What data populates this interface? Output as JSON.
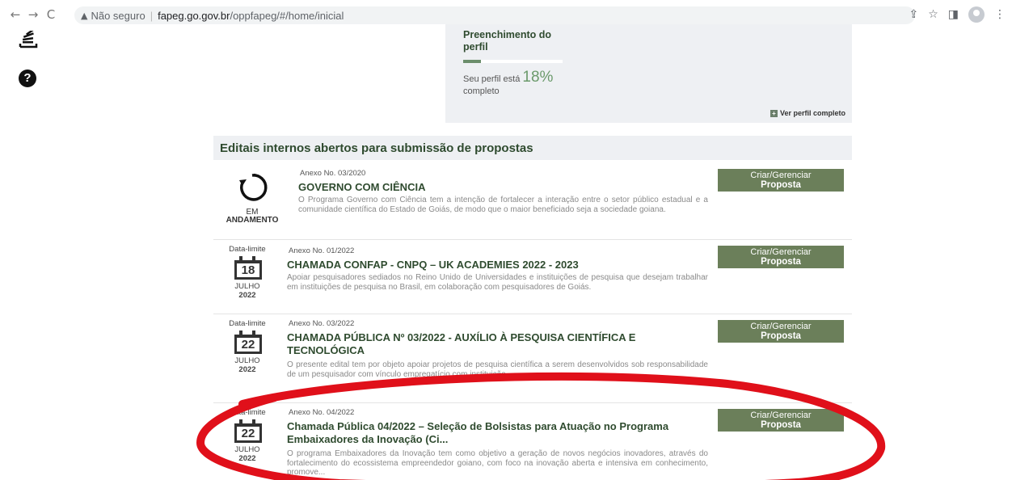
{
  "browser": {
    "insecure_label": "Não seguro",
    "url_host": "fapeg.go.gov.br",
    "url_path": "/oppfapeg/#/home/inicial"
  },
  "profile": {
    "title": "Preenchimento do perfil",
    "progress": 0.18,
    "status_prefix": "Seu perfil está",
    "percent": "18%",
    "status_suffix": "completo",
    "link_label": "Ver perfil completo"
  },
  "section": {
    "heading": "Editais internos abertos para submissão de propostas"
  },
  "notices": [
    {
      "annex": "Anexo No. 03/2020",
      "title": "GOVERNO COM CIÊNCIA",
      "desc": "O Programa Governo com Ciência tem a intenção de fortalecer a interação entre o setor público estadual e a comunidade científica do Estado de Goiás, de modo que o maior beneficiado seja a sociedade goiana.",
      "status_line1": "EM",
      "status_line2": "ANDAMENTO",
      "button_line1": "Criar/Gerenciar",
      "button_line2": "Proposta"
    },
    {
      "annex": "Anexo No. 01/2022",
      "title": "CHAMADA CONFAP - CNPQ – UK ACADEMIES 2022 - 2023",
      "desc": "Apoiar pesquisadores sediados no Reino Unido de Universidades e instituições de pesquisa que desejam trabalhar em instituições de pesquisa no Brasil, em colaboração com pesquisadores de Goiás.",
      "deadline_label": "Data-limite",
      "day": "18",
      "month": "JULHO",
      "year": "2022",
      "button_line1": "Criar/Gerenciar",
      "button_line2": "Proposta"
    },
    {
      "annex": "Anexo No. 03/2022",
      "title": "CHAMADA PÚBLICA Nº 03/2022 - AUXÍLIO À PESQUISA CIENTÍFICA E TECNOLÓGICA",
      "desc": "O presente edital tem por objeto apoiar projetos de pesquisa científica a serem desenvolvidos sob responsabilidade de um pesquisador com vínculo empregatício com instituição ...",
      "deadline_label": "Data-limite",
      "day": "22",
      "month": "JULHO",
      "year": "2022",
      "button_line1": "Criar/Gerenciar",
      "button_line2": "Proposta"
    },
    {
      "annex": "Anexo No. 04/2022",
      "title": "Chamada Pública 04/2022 – Seleção de Bolsistas para Atuação no Programa Embaixadores da Inovação (Ci...",
      "desc": "O programa Embaixadores da Inovação tem como objetivo a geração de novos negócios inovadores, através do fortalecimento do ecossistema empreendedor goiano, com foco na inovação aberta e intensiva em conhecimento, promove...",
      "deadline_label": "Data-limite",
      "day": "22",
      "month": "JULHO",
      "year": "2022",
      "button_line1": "Criar/Gerenciar",
      "button_line2": "Proposta"
    }
  ],
  "colors": {
    "accent_green": "#2f4b2f",
    "button_green": "#6b7f5a",
    "panel_bg": "#eef0f3",
    "highlight_red": "#e0101a"
  }
}
